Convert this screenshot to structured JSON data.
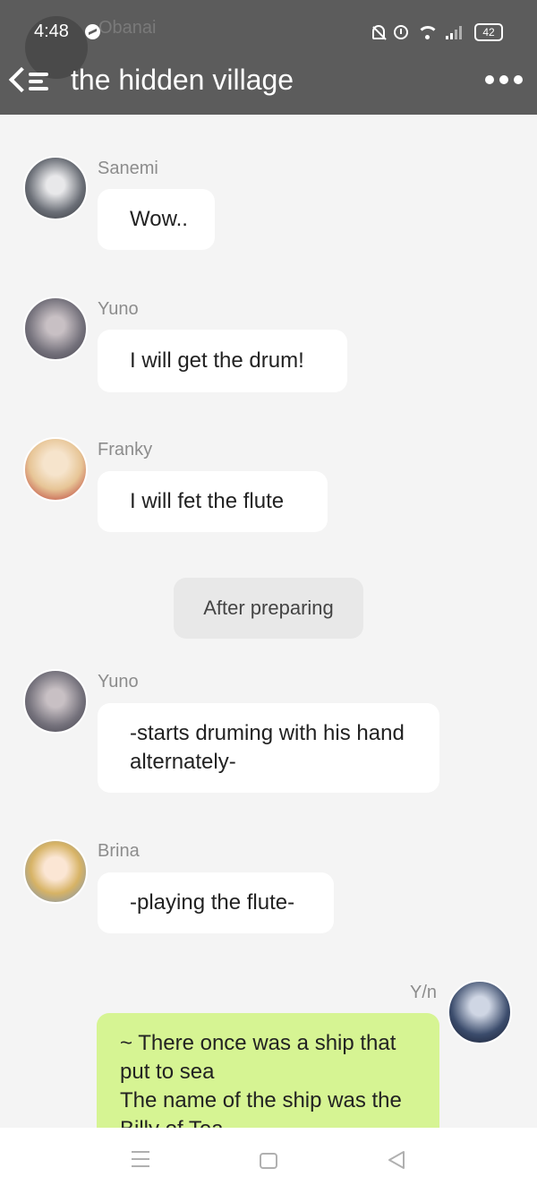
{
  "status_bar": {
    "time": "4:48",
    "battery": "42",
    "icons": [
      "messenger-icon",
      "bell-off-icon",
      "alarm-icon",
      "wifi-icon",
      "signal-icon",
      "battery-icon"
    ]
  },
  "header": {
    "title": "the hidden village",
    "ghost_name": "Obanai",
    "icons": [
      "back-menu-icon",
      "more-icon"
    ]
  },
  "colors": {
    "header_bg": "#5c5c5c",
    "chat_bg": "#f4f4f4",
    "bubble_other": "#ffffff",
    "bubble_self": "#d6f493",
    "system_bubble": "#e8e8e8"
  },
  "messages": [
    {
      "name": "Sanemi",
      "text": "Wow..",
      "avatar_color": "#6b6f77"
    },
    {
      "name": "Yuno",
      "text": "I will get the drum!",
      "avatar_color": "#75727c"
    },
    {
      "name": "Franky",
      "text": "I will fet the flute",
      "avatar_color": "#e7c596"
    },
    {
      "system_text": "After preparing"
    },
    {
      "name": "Yuno",
      "text": "-starts druming with his hand alternately-",
      "avatar_color": "#75727c"
    },
    {
      "name": "Brina",
      "text": "-playing the flute-",
      "avatar_color": "#d7b365"
    },
    {
      "name": "Y/n",
      "text": "~ There once was a ship that put to sea\nThe name of the ship was the Billy of Tea",
      "avatar_color": "#3b4c6c",
      "self": true
    }
  ],
  "nav": {
    "icons": [
      "nav-menu-icon",
      "nav-home-icon",
      "nav-back-icon"
    ]
  }
}
